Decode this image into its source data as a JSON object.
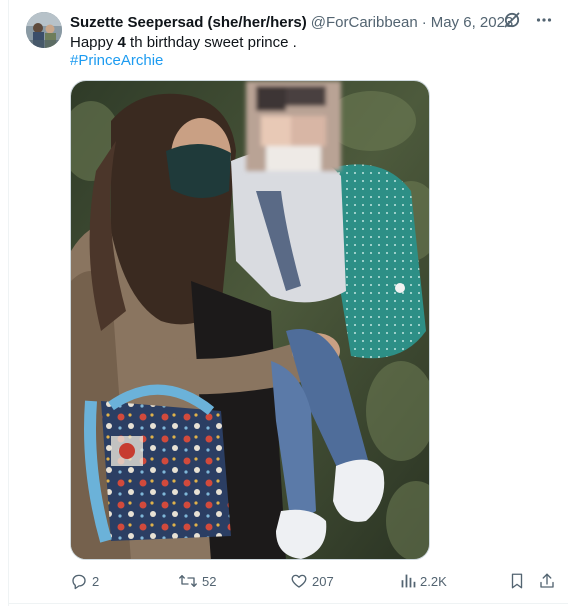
{
  "tweet": {
    "author": {
      "display_name": "Suzette Seepersad (she/her/hers)",
      "handle": "@ForCaribbean"
    },
    "separator": "·",
    "date": "May 6, 2023",
    "text": {
      "before": "Happy ",
      "number": "4",
      "after": " th birthday sweet prince ."
    },
    "hashtag": "#PrinceArchie",
    "header_icons": [
      "grok-icon",
      "more-options-icon"
    ],
    "stats": {
      "replies": "2",
      "reposts": "52",
      "likes": "207",
      "views": "2.2K"
    }
  },
  "colors": {
    "link": "#1d9bf0",
    "secondary_text": "#536471",
    "primary_text": "#0f1419",
    "border": "#cfd9de"
  }
}
